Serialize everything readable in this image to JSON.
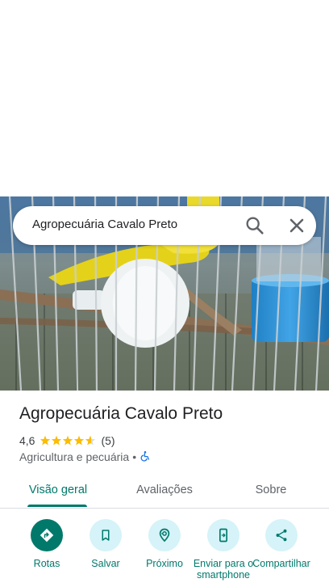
{
  "search": {
    "query": "Agropecuária Cavalo Preto"
  },
  "place": {
    "name": "Agropecuária Cavalo Preto",
    "rating": "4,6",
    "review_count": "(5)",
    "stars": 4.6,
    "category": "Agricultura e pecuária",
    "separator": "•"
  },
  "tabs": [
    {
      "label": "Visão geral",
      "active": true
    },
    {
      "label": "Avaliações",
      "active": false
    },
    {
      "label": "Sobre",
      "active": false
    }
  ],
  "actions": [
    {
      "label": "Rotas",
      "icon": "directions-icon"
    },
    {
      "label": "Salvar",
      "icon": "bookmark-icon"
    },
    {
      "label": "Próximo",
      "icon": "nearby-icon"
    },
    {
      "label": "Enviar para o smartphone",
      "icon": "send-to-phone-icon"
    },
    {
      "label": "Compartilhar",
      "icon": "share-icon"
    }
  ],
  "colors": {
    "accent": "#00796b",
    "star": "#fbbc04",
    "action_bg": "#d5f3f8",
    "accessibility_blue": "#1a73e8"
  }
}
